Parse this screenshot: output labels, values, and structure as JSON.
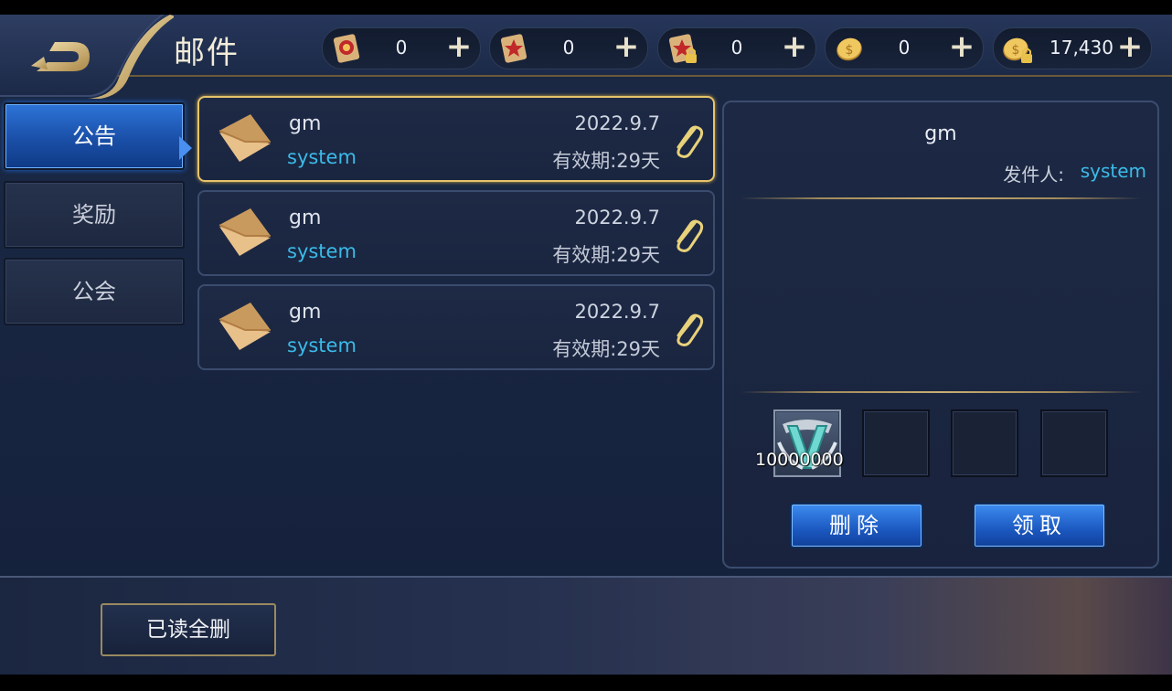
{
  "header": {
    "title": "邮件",
    "resources": [
      {
        "icon": "red-scroll-icon",
        "value": "0"
      },
      {
        "icon": "star-scroll-icon",
        "value": "0"
      },
      {
        "icon": "locked-scroll-icon",
        "value": "0"
      },
      {
        "icon": "gold-coin-icon",
        "value": "0"
      },
      {
        "icon": "locked-gold-coin-icon",
        "value": "17,430"
      }
    ],
    "plus_label": "+"
  },
  "tabs": [
    {
      "label": "公告",
      "active": true
    },
    {
      "label": "奖励",
      "active": false
    },
    {
      "label": "公会",
      "active": false
    }
  ],
  "mails": [
    {
      "sender": "gm",
      "from": "system",
      "date": "2022.9.7",
      "expiry": "有效期:29天",
      "selected": true
    },
    {
      "sender": "gm",
      "from": "system",
      "date": "2022.9.7",
      "expiry": "有效期:29天",
      "selected": false
    },
    {
      "sender": "gm",
      "from": "system",
      "date": "2022.9.7",
      "expiry": "有效期:29天",
      "selected": false
    }
  ],
  "detail": {
    "title": "gm",
    "sender_label": "发件人:",
    "sender_value": "system",
    "attachments": [
      {
        "icon": "v-emblem-icon",
        "count": "10000000"
      },
      {
        "icon": "",
        "count": ""
      },
      {
        "icon": "",
        "count": ""
      },
      {
        "icon": "",
        "count": ""
      }
    ],
    "delete_label": "删除",
    "claim_label": "领取"
  },
  "footer": {
    "delete_read_label": "已读全删"
  },
  "colors": {
    "accent_blue": "#3bbbe8",
    "gold_border": "#e6c46a",
    "button_blue": "#1b58c0"
  }
}
